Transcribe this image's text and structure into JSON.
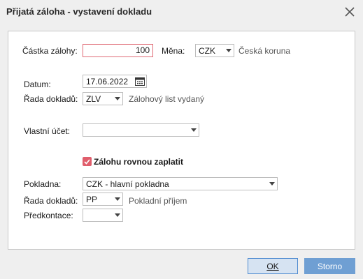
{
  "window": {
    "title": "Přijatá záloha - vystavení dokladu"
  },
  "form": {
    "castka_label": "Částka zálohy:",
    "castka_value": "100",
    "mena_label": "Měna:",
    "mena_value": "CZK",
    "mena_name": "Česká koruna",
    "datum_label": "Datum:",
    "datum_value": "17.06.2022",
    "rada_label": "Řada dokladů:",
    "rada_value": "ZLV",
    "rada_name": "Zálohový list vydaný",
    "ucet_label": "Vlastní účet:",
    "ucet_value": "",
    "zaplatit_label": "Zálohu rovnou zaplatit",
    "zaplatit_checked": true,
    "pokladna_label": "Pokladna:",
    "pokladna_value": "CZK - hlavní pokladna",
    "rada2_label": "Řada dokladů:",
    "rada2_value": "PP",
    "rada2_name": "Pokladní příjem",
    "predkontace_label": "Předkontace:",
    "predkontace_value": ""
  },
  "buttons": {
    "ok": "OK",
    "cancel": "Storno"
  },
  "colors": {
    "accent": "#e05e6c",
    "primary": "#6f9fd3"
  },
  "icons": {
    "close": "close-icon",
    "calendar": "calendar-icon",
    "dropdown": "chevron-down-icon",
    "check": "check-icon"
  }
}
